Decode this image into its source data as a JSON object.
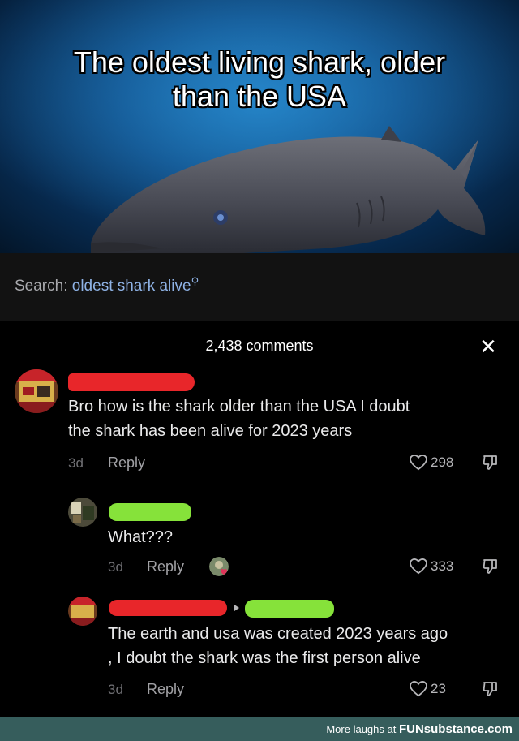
{
  "meme": {
    "title_line1": "The oldest living shark, older",
    "title_line2": "than the USA"
  },
  "search": {
    "label": "Search:",
    "query": "oldest shark alive",
    "icon": "search-icon"
  },
  "comments_panel": {
    "count_label": "2,438 comments",
    "close_icon": "close-icon",
    "comments": [
      {
        "text_line1": "Bro how is the shark older than the USA I doubt",
        "text_line2": "the shark has been alive for 2023 years",
        "age": "3d",
        "reply_label": "Reply",
        "likes": "298"
      },
      {
        "text_line1": "What???",
        "age": "3d",
        "reply_label": "Reply",
        "likes": "333"
      },
      {
        "text_line1": "The earth and usa was created 2023 years ago",
        "text_line2": ", I doubt the shark was the first person alive",
        "age": "3d",
        "reply_label": "Reply",
        "likes": "23"
      }
    ]
  },
  "footer": {
    "prefix": "More laughs at ",
    "brand": "FUNsubstance.com"
  },
  "colors": {
    "accent_search": "#8fb3e6",
    "redaction_red": "#e8262a",
    "redaction_green": "#86e23a",
    "footer_bg": "#365d5c"
  }
}
